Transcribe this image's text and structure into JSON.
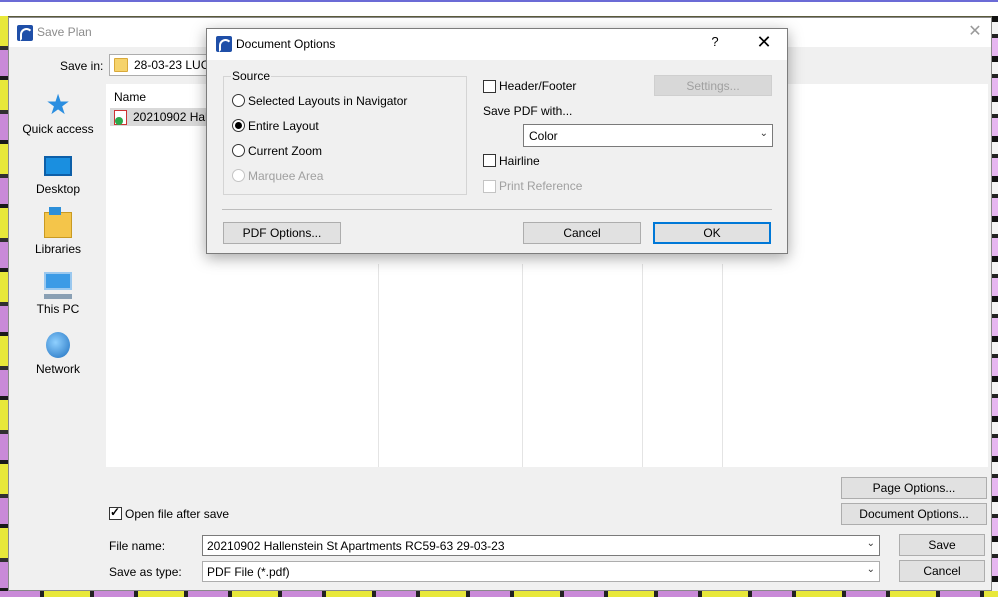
{
  "save_window": {
    "title": "Save Plan",
    "save_in_label": "Save in:",
    "save_in_value": "28-03-23 LUC R",
    "places": [
      {
        "label": "Quick access",
        "icon": "quick-access-star-icon"
      },
      {
        "label": "Desktop",
        "icon": "desktop-icon"
      },
      {
        "label": "Libraries",
        "icon": "libraries-icon"
      },
      {
        "label": "This PC",
        "icon": "this-pc-icon"
      },
      {
        "label": "Network",
        "icon": "network-icon"
      }
    ],
    "list_header": "Name",
    "files": [
      {
        "name": "20210902 Halle",
        "icon": "pdf-file-icon"
      }
    ],
    "open_after_save_label": "Open file after save",
    "open_after_save_checked": true,
    "page_options_label": "Page Options...",
    "document_options_label": "Document Options...",
    "file_name_label": "File name:",
    "file_name_value": "20210902 Hallenstein St Apartments RC59-63 29-03-23",
    "save_as_type_label": "Save as type:",
    "save_as_type_value": "PDF File (*.pdf)",
    "save_label": "Save",
    "cancel_label": "Cancel"
  },
  "document_options": {
    "title": "Document Options",
    "help_label": "?",
    "source_label": "Source",
    "source_options": [
      {
        "label": "Selected Layouts in Navigator",
        "selected": false,
        "enabled": true
      },
      {
        "label": "Entire Layout",
        "selected": true,
        "enabled": true
      },
      {
        "label": "Current Zoom",
        "selected": false,
        "enabled": true
      },
      {
        "label": "Marquee Area",
        "selected": false,
        "enabled": false
      }
    ],
    "header_footer_label": "Header/Footer",
    "header_footer_checked": false,
    "settings_label": "Settings...",
    "save_pdf_with_label": "Save PDF with...",
    "save_pdf_with_value": "Color",
    "hairline_label": "Hairline",
    "hairline_checked": false,
    "print_reference_label": "Print Reference",
    "print_reference_enabled": false,
    "pdf_options_label": "PDF Options...",
    "cancel_label": "Cancel",
    "ok_label": "OK"
  }
}
